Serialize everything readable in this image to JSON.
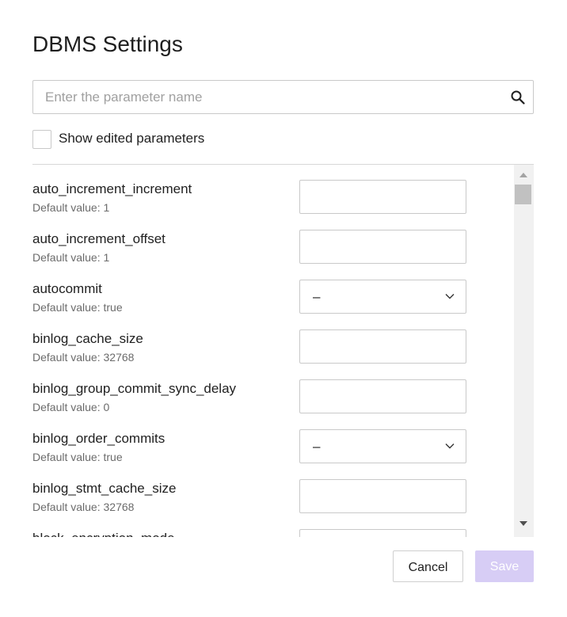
{
  "dialog": {
    "title": "DBMS Settings",
    "search": {
      "placeholder": "Enter the parameter name",
      "value": "",
      "icon": "search-icon"
    },
    "filter": {
      "label": "Show edited parameters",
      "checked": false
    },
    "params": [
      {
        "name": "auto_increment_increment",
        "default": "Default value: 1",
        "control": "input",
        "value": ""
      },
      {
        "name": "auto_increment_offset",
        "default": "Default value: 1",
        "control": "input",
        "value": ""
      },
      {
        "name": "autocommit",
        "default": "Default value: true",
        "control": "select",
        "value": "–"
      },
      {
        "name": "binlog_cache_size",
        "default": "Default value: 32768",
        "control": "input",
        "value": ""
      },
      {
        "name": "binlog_group_commit_sync_delay",
        "default": "Default value: 0",
        "control": "input",
        "value": ""
      },
      {
        "name": "binlog_order_commits",
        "default": "Default value: true",
        "control": "select",
        "value": "–"
      },
      {
        "name": "binlog_stmt_cache_size",
        "default": "Default value: 32768",
        "control": "input",
        "value": ""
      },
      {
        "name": "block_encryption_mode",
        "default": "",
        "control": "input",
        "value": ""
      }
    ],
    "buttons": {
      "cancel": "Cancel",
      "save": "Save"
    },
    "colors": {
      "save_disabled_bg": "#d7cdf5",
      "border": "#c9c9c9",
      "scroll_track": "#f1f1f1"
    }
  }
}
